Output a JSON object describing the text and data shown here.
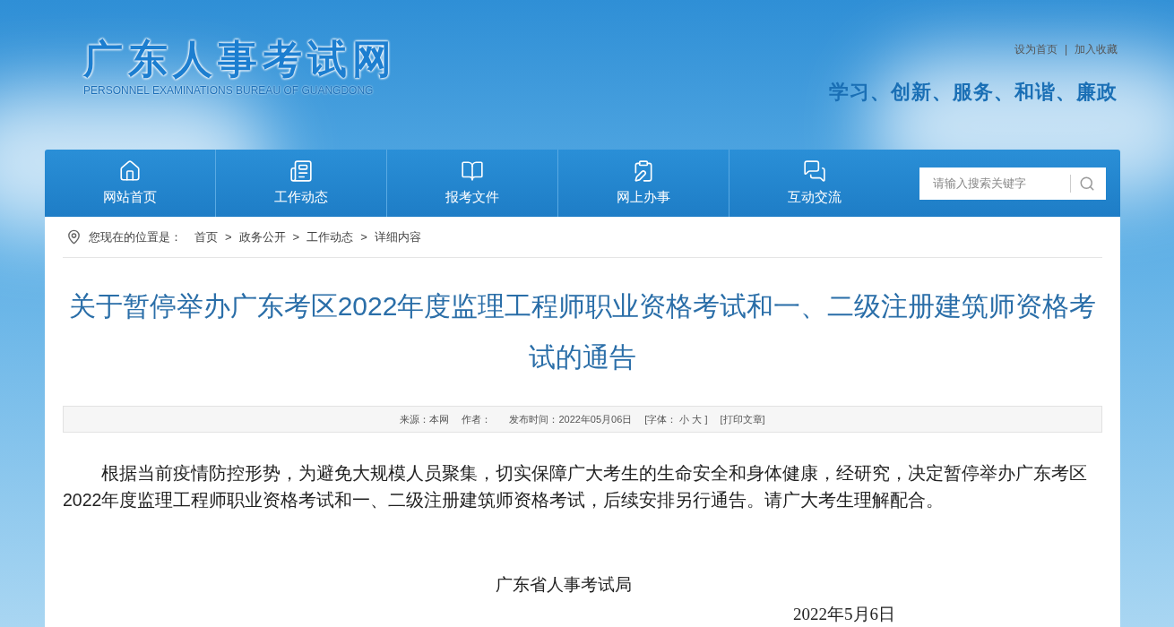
{
  "header": {
    "logo_title": "广东人事考试网",
    "logo_subtitle": "PERSONNEL EXAMINATIONS BUREAU OF GUANGDONG",
    "top_links": [
      "设为首页",
      "加入收藏"
    ],
    "top_separator": "|",
    "slogan": "学习、创新、服务、和谐、廉政"
  },
  "nav": {
    "items": [
      "网站首页",
      "工作动态",
      "报考文件",
      "网上办事",
      "互动交流"
    ],
    "search": {
      "placeholder": "请输入搜索关键字"
    }
  },
  "breadcrumb": {
    "label": "您现在的位置是：",
    "items": [
      "首页",
      "政务公开",
      "工作动态",
      "详细内容"
    ],
    "separator": ">"
  },
  "article": {
    "title": "关于暂停举办广东考区2022年度监理工程师职业资格考试和一、二级注册建筑师资格考试的通告",
    "meta": {
      "source": "来源：本网",
      "author": "作者：",
      "date": "发布时间：2022年05月06日",
      "font_label": "[字体：",
      "font_options": [
        "小",
        "大"
      ],
      "font_close": "]",
      "print": "[打印文章]"
    },
    "body": "根据当前疫情防控形势，为避免大规模人员聚集，切实保障广大考生的生命安全和身体健康，经研究，决定暂停举办广东考区2022年度监理工程师职业资格考试和一、二级注册建筑师资格考试，后续安排另行通告。请广大考生理解配合。",
    "signature": "广东省人事考试局",
    "sign_date": "2022年5月6日"
  }
}
